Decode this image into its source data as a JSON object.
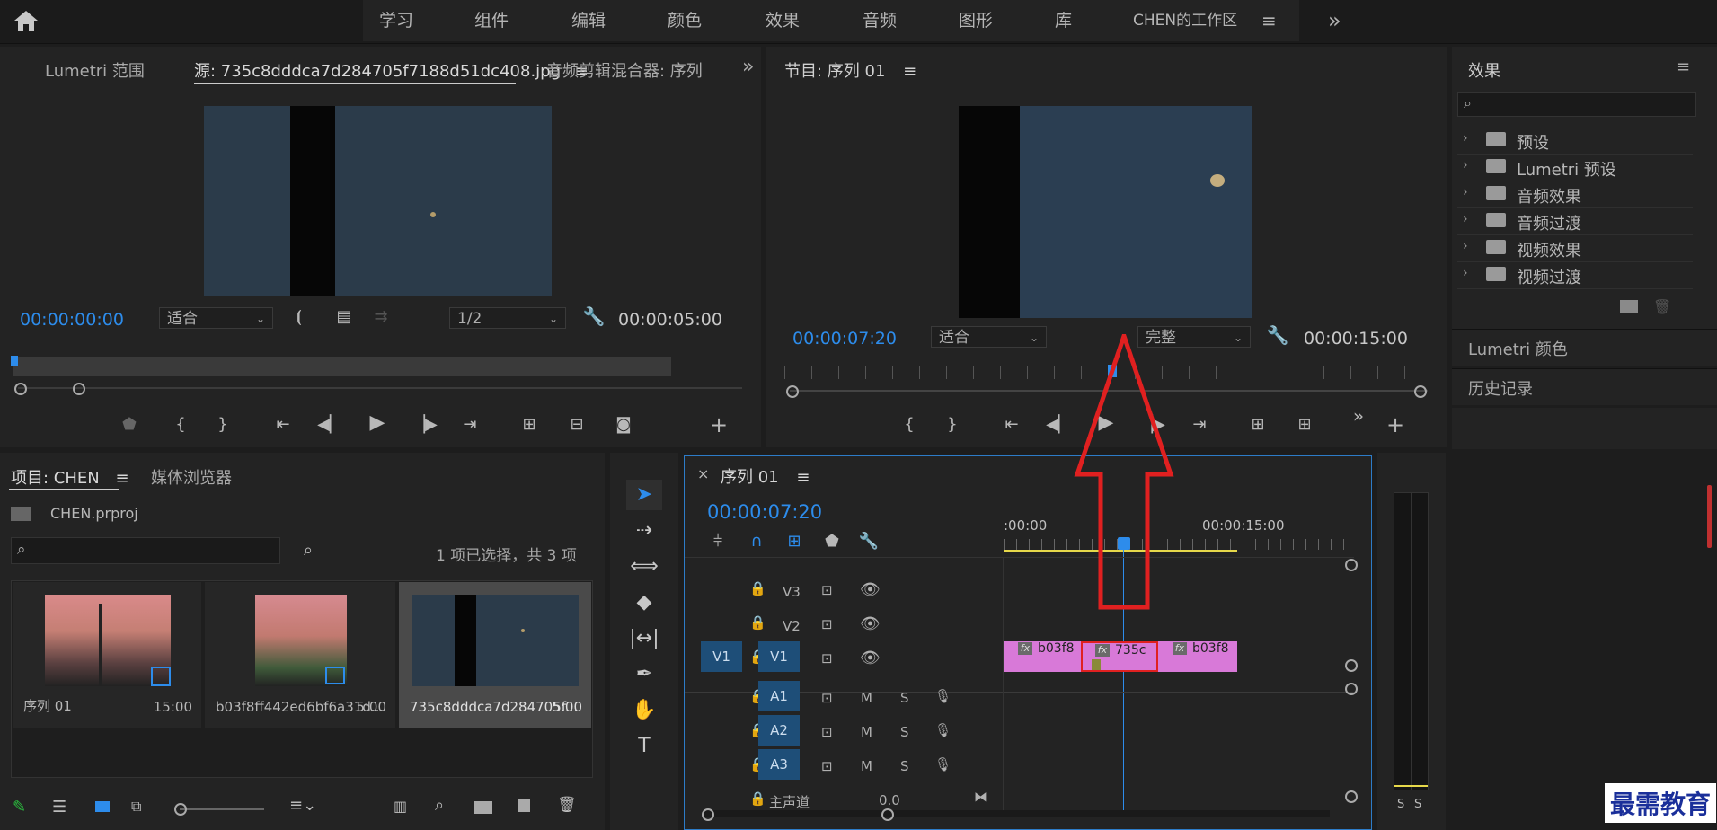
{
  "topbar": {
    "tabs": [
      "学习",
      "组件",
      "编辑",
      "颜色",
      "效果",
      "音频",
      "图形",
      "库"
    ],
    "workspace": "CHEN的工作区",
    "more": "»"
  },
  "source_panel": {
    "tab_lumetri": "Lumetri 范围",
    "tab_source": "源: 735c8dddca7d284705f7188d51dc408.jpg",
    "tab_audio": "音频剪辑混合器: 序列",
    "timecode": "00:00:00:00",
    "fit": "适合",
    "resolution": "1/2",
    "duration": "00:00:05:00"
  },
  "program_panel": {
    "title": "节目: 序列 01",
    "timecode": "00:00:07:20",
    "fit": "适合",
    "quality": "完整",
    "duration": "00:00:15:00"
  },
  "effects_panel": {
    "title": "效果",
    "items": [
      "预设",
      "Lumetri 预设",
      "音频效果",
      "音频过渡",
      "视频效果",
      "视频过渡"
    ],
    "lumetri_color": "Lumetri 颜色",
    "history": "历史记录"
  },
  "project_panel": {
    "tab_project": "项目: CHEN",
    "tab_media": "媒体浏览器",
    "file": "CHEN.prproj",
    "selection_info": "1 项已选择，共 3 项",
    "items": [
      {
        "name": "序列 01",
        "duration": "15:00"
      },
      {
        "name": "b03f8ff442ed6bf6a31d...",
        "duration": "5:00"
      },
      {
        "name": "735c8dddca7d284705f...",
        "duration": "5:00"
      }
    ]
  },
  "timeline": {
    "close": "×",
    "title": "序列 01",
    "timecode": "00:00:07:20",
    "ruler_start": ":00:00",
    "ruler_mid": "00:00:15:00",
    "tracks": {
      "video": [
        "V3",
        "V2",
        "V1"
      ],
      "audio": [
        "A1",
        "A2",
        "A3"
      ],
      "source_patch": "V1",
      "master": "主声道",
      "master_value": "0.0",
      "m": "M",
      "s": "S"
    },
    "clips": [
      "b03f8",
      "735c",
      "b03f8"
    ],
    "fx": "fx"
  },
  "meter": {
    "s1": "S",
    "s2": "S"
  },
  "watermark": "最需教育",
  "colors": {
    "accent": "#2d8ceb",
    "clip": "#d879d8",
    "arrow": "#e02020"
  }
}
